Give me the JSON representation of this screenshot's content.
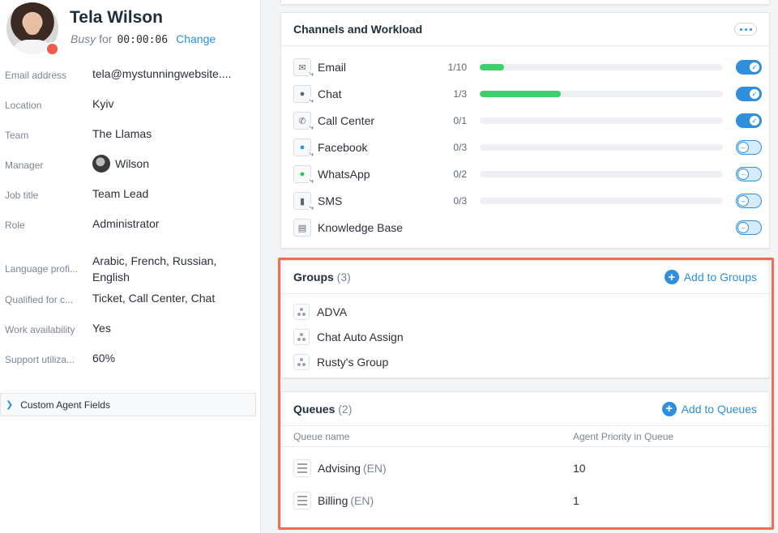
{
  "agent": {
    "name": "Tela Wilson",
    "status": "Busy",
    "status_for": "for",
    "timer": "00:00:06",
    "change_label": "Change"
  },
  "fields": [
    {
      "label": "Email address",
      "value": "tela@mystunningwebsite...."
    },
    {
      "label": "Location",
      "value": "Kyiv"
    },
    {
      "label": "Team",
      "value": "The Llamas"
    },
    {
      "label": "Manager",
      "value": "Wilson"
    },
    {
      "label": "Job title",
      "value": "Team Lead"
    },
    {
      "label": "Role",
      "value": "Administrator"
    },
    {
      "label": "Language profi...",
      "value": "Arabic, French, Russian, English"
    },
    {
      "label": "Qualified for c...",
      "value": "Ticket, Call Center, Chat"
    },
    {
      "label": "Work availability",
      "value": "Yes"
    },
    {
      "label": "Support utiliza...",
      "value": "60%"
    }
  ],
  "custom_fields_label": "Custom Agent Fields",
  "channels": {
    "title": "Channels and Workload",
    "items": [
      {
        "name": "Email",
        "load": "1/10",
        "fill": 0.1,
        "enabled": true,
        "icon": "envelope-icon"
      },
      {
        "name": "Chat",
        "load": "1/3",
        "fill": 0.333,
        "enabled": true,
        "icon": "chat-bubble-icon"
      },
      {
        "name": "Call Center",
        "load": "0/1",
        "fill": 0,
        "enabled": true,
        "icon": "phone-icon"
      },
      {
        "name": "Facebook",
        "load": "0/3",
        "fill": 0,
        "enabled": false,
        "icon": "messenger-icon"
      },
      {
        "name": "WhatsApp",
        "load": "0/2",
        "fill": 0,
        "enabled": false,
        "icon": "whatsapp-icon"
      },
      {
        "name": "SMS",
        "load": "0/3",
        "fill": 0,
        "enabled": false,
        "icon": "mobile-icon"
      },
      {
        "name": "Knowledge Base",
        "load": "",
        "fill": null,
        "enabled": false,
        "icon": "book-icon"
      }
    ]
  },
  "groups": {
    "title": "Groups",
    "count": "(3)",
    "add_label": "Add to Groups",
    "items": [
      "ADVA",
      "Chat Auto Assign",
      "Rusty's Group"
    ]
  },
  "queues": {
    "title": "Queues",
    "count": "(2)",
    "add_label": "Add to Queues",
    "col_name": "Queue name",
    "col_priority": "Agent Priority in Queue",
    "items": [
      {
        "name": "Billing",
        "lang": "(EN)",
        "priority": "1"
      },
      {
        "name": "Advising",
        "lang": "(EN)",
        "priority": "10"
      }
    ]
  },
  "colors": {
    "accent": "#2f8fdc",
    "progress": "#3ccf6b",
    "status_busy": "#ef5a4a",
    "highlight": "#ef6e55"
  }
}
